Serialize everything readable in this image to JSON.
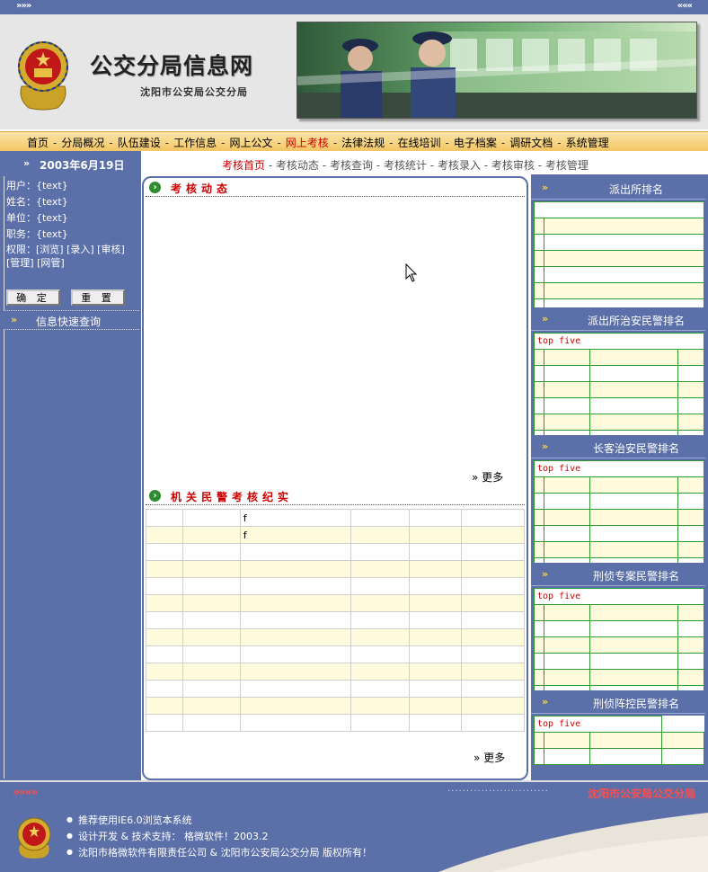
{
  "header": {
    "top_left_arrows": "»»»",
    "top_right_arrows": "«««",
    "site_title": "公交分局信息网",
    "site_subtitle": "沈阳市公安局公交分局"
  },
  "nav": {
    "items": [
      "首页",
      "分局概况",
      "队伍建设",
      "工作信息",
      "网上公文",
      "网上考核",
      "法律法规",
      "在线培训",
      "电子档案",
      "调研文档",
      "系统管理"
    ],
    "active": "网上考核",
    "separator": "-"
  },
  "sidebar": {
    "date": "2003年6月19日",
    "user_label": "用户：",
    "user_value": "{text}",
    "name_label": "姓名：",
    "name_value": "{text}",
    "unit_label": "单位：",
    "unit_value": "{text}",
    "duty_label": "职务：",
    "duty_value": "{text}",
    "perm_text": "权限：[浏览] [录入] [审核] [管理] [网管]",
    "confirm_button": "确 定",
    "reset_button": "重 置",
    "quick_query_title": "信息快速查询"
  },
  "subnav": {
    "items": [
      "考核首页",
      "考核动态",
      "考核查询",
      "考核统计",
      "考核录入",
      "考核审核",
      "考核管理"
    ],
    "active": "考核首页"
  },
  "main": {
    "section1_title": "考核动态",
    "section1_more": "更多",
    "section2_title": "机关民警考核纪实",
    "section2_more": "更多",
    "table_rows": [
      [
        "",
        "",
        "f",
        "",
        "",
        ""
      ],
      [
        "",
        "",
        "f",
        "",
        "",
        ""
      ],
      [
        "",
        "",
        "",
        "",
        "",
        ""
      ],
      [
        "",
        "",
        "",
        "",
        "",
        ""
      ],
      [
        "",
        "",
        "",
        "",
        "",
        ""
      ],
      [
        "",
        "",
        "",
        "",
        "",
        ""
      ],
      [
        "",
        "",
        "",
        "",
        "",
        ""
      ],
      [
        "",
        "",
        "",
        "",
        "",
        ""
      ],
      [
        "",
        "",
        "",
        "",
        "",
        ""
      ],
      [
        "",
        "",
        "",
        "",
        "",
        ""
      ],
      [
        "",
        "",
        "",
        "",
        "",
        ""
      ],
      [
        "",
        "",
        "",
        "",
        "",
        ""
      ],
      [
        "",
        "",
        "",
        "",
        "",
        ""
      ]
    ]
  },
  "rankings": {
    "arrow": "»",
    "panels": [
      {
        "title": "派出所排名",
        "subtitle": ""
      },
      {
        "title": "派出所治安民警排名",
        "subtitle": "top five"
      },
      {
        "title": "长客治安民警排名",
        "subtitle": "top five"
      },
      {
        "title": "刑侦专案民警排名",
        "subtitle": "top five"
      },
      {
        "title": "刑侦阵控民警排名",
        "subtitle": "top five"
      }
    ]
  },
  "footer": {
    "left_arrows": "»»»»",
    "org_name": "沈阳市公安局公交分局",
    "lines": [
      "推荐使用IE6.0浏览本系统",
      "设计开发 & 技术支持： 格微软件！2003.2",
      "沈阳市格微软件有限责任公司 & 沈阳市公安局公交分局 版权所有！"
    ]
  }
}
